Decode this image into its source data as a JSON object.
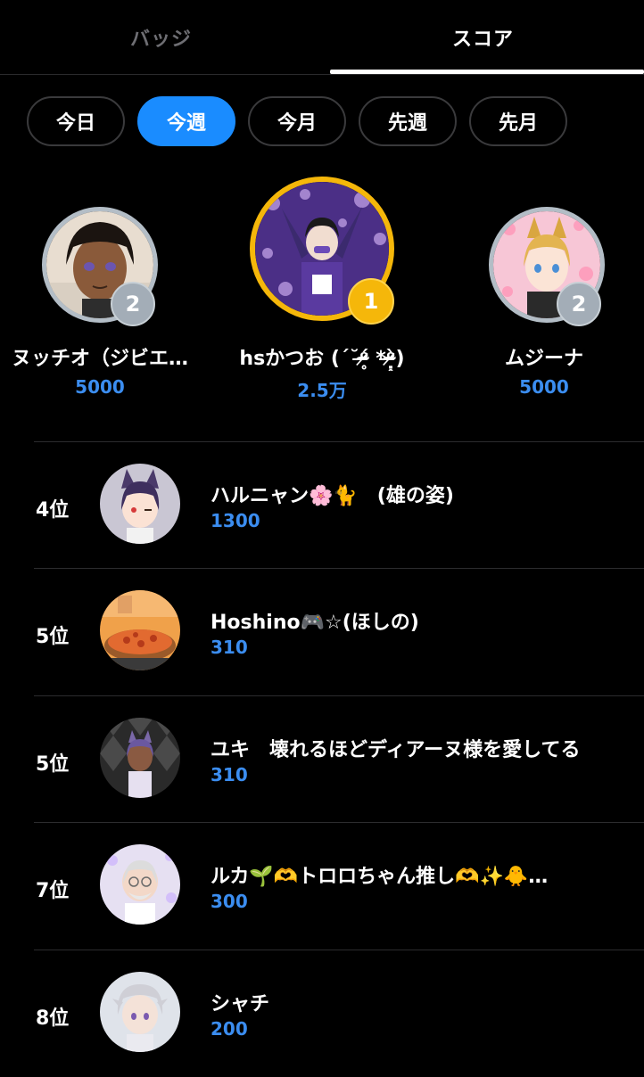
{
  "tabs": {
    "badges_label": "バッジ",
    "score_label": "スコア",
    "active": "score"
  },
  "filters": {
    "items": [
      {
        "label": "今日",
        "active": false
      },
      {
        "label": "今週",
        "active": true
      },
      {
        "label": "今月",
        "active": false
      },
      {
        "label": "先週",
        "active": false
      },
      {
        "label": "先月",
        "active": false
      }
    ]
  },
  "podium": {
    "left": {
      "rank": "2",
      "name": "ヌッチオ（ジビエ…",
      "score": "5000"
    },
    "center": {
      "rank": "1",
      "name": "hsかつお (ˊ˘ᵒ̴̶̷̥́ *ᵒ̴̶̷̣̥̀)",
      "score": "2.5万"
    },
    "right": {
      "rank": "2",
      "name": "ムジーナ",
      "score": "5000"
    }
  },
  "list": [
    {
      "rank": "4位",
      "name": "ハルニャン🌸🐈　(雄の姿)",
      "score": "1300"
    },
    {
      "rank": "5位",
      "name": "Hoshino🎮☆(ほしの)",
      "score": "310"
    },
    {
      "rank": "5位",
      "name": "ユキ　壊れるほどディアーヌ様を愛してる",
      "score": "310"
    },
    {
      "rank": "7位",
      "name": "ルカ🌱🫶トロロちゃん推し🫶✨🐥…",
      "score": "300"
    },
    {
      "rank": "8位",
      "name": "シャチ",
      "score": "200"
    }
  ],
  "colors": {
    "accent": "#1a8cff",
    "score_text": "#3b8df0",
    "gold": "#f5b70a",
    "silver": "#a3adb7"
  }
}
